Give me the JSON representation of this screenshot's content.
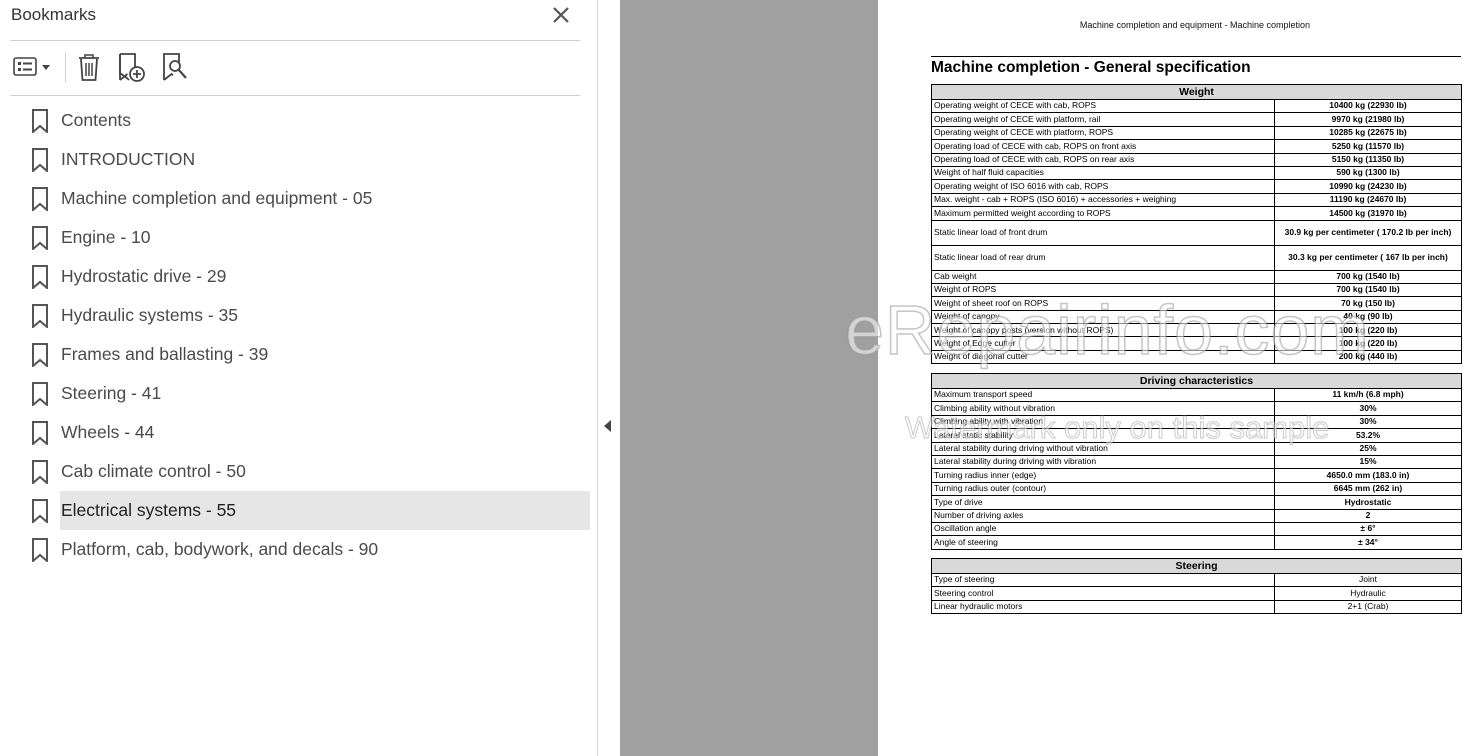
{
  "bookmarks_panel": {
    "title": "Bookmarks",
    "toolbar": {
      "options_icon": "list-options-icon",
      "delete_icon": "trash-icon",
      "new_bookmark_icon": "bookmark-add-icon",
      "find_bookmark_icon": "bookmark-search-icon"
    },
    "items": [
      {
        "label": "Contents"
      },
      {
        "label": "INTRODUCTION"
      },
      {
        "label": "Machine completion and equipment - 05"
      },
      {
        "label": "Engine - 10"
      },
      {
        "label": "Hydrostatic drive - 29"
      },
      {
        "label": "Hydraulic systems - 35"
      },
      {
        "label": "Frames and ballasting - 39"
      },
      {
        "label": "Steering - 41"
      },
      {
        "label": "Wheels - 44"
      },
      {
        "label": "Cab climate control - 50"
      },
      {
        "label": "Electrical systems - 55",
        "selected": true
      },
      {
        "label": "Platform, cab, bodywork, and decals - 90"
      }
    ]
  },
  "document": {
    "header": "Machine completion and equipment - Machine completion",
    "title": "Machine completion - General specification",
    "weight": {
      "heading": "Weight",
      "rows": [
        [
          "Operating weight of CECE with cab, ROPS",
          "10400 kg (22930 lb)"
        ],
        [
          "Operating weight of CECE with platform, rail",
          "9970 kg (21980 lb)"
        ],
        [
          "Operating weight of CECE with platform, ROPS",
          "10285 kg (22675 lb)"
        ],
        [
          "Operating load of CECE with cab, ROPS on front axis",
          "5250 kg (11570 lb)"
        ],
        [
          "Operating load of CECE with cab, ROPS on rear axis",
          "5150 kg (11350 lb)"
        ],
        [
          "Weight of half fluid capacities",
          "590 kg (1300 lb)"
        ],
        [
          "Operating weight of ISO 6016 with cab, ROPS",
          "10990 kg (24230 lb)"
        ],
        [
          "Max. weight - cab + ROPS (ISO 6016) + accessories + weighing",
          "11190 kg (24670 lb)"
        ],
        [
          "Maximum permitted weight according to ROPS",
          "14500 kg (31970 lb)"
        ],
        [
          "Static linear load of front drum",
          "30.9 kg per centimeter ( 170.2 lb per inch)"
        ],
        [
          "Static linear load of rear drum",
          "30.3 kg per centimeter ( 167 lb per inch)"
        ],
        [
          "Cab weight",
          "700 kg (1540 lb)"
        ],
        [
          "Weight of ROPS",
          "700 kg (1540 lb)"
        ],
        [
          "Weight of sheet roof on ROPS",
          "70 kg (150 lb)"
        ],
        [
          "Weight of canopy",
          "40 kg (90 lb)"
        ],
        [
          "Weight of canopy posts (version without ROPS)",
          "100 kg (220 lb)"
        ],
        [
          "Weight of Edge cutter",
          "100 kg (220 lb)"
        ],
        [
          "Weight of diagonal cutter",
          "200 kg (440 lb)"
        ]
      ]
    },
    "driving": {
      "heading": "Driving characteristics",
      "rows": [
        [
          "Maximum transport speed",
          "11 km/h (6.8 mph)"
        ],
        [
          "Climbing ability without vibration",
          "30%"
        ],
        [
          "Climbing ability with vibration",
          "30%"
        ],
        [
          "Lateral static stability",
          "53.2%"
        ],
        [
          "Lateral stability during driving without vibration",
          "25%"
        ],
        [
          "Lateral stability during driving with vibration",
          "15%"
        ],
        [
          "Turning radius inner (edge)",
          "4650.0 mm (183.0 in)"
        ],
        [
          "Turning radius outer (contour)",
          "6645 mm (262 in)"
        ],
        [
          "Type of drive",
          "Hydrostatic"
        ],
        [
          "Number of driving axles",
          "2"
        ],
        [
          "Oscillation angle",
          "± 6°"
        ],
        [
          "Angle of steering",
          "± 34°"
        ]
      ]
    },
    "steering": {
      "heading": "Steering",
      "rows": [
        [
          "Type of steering",
          "Joint"
        ],
        [
          "Steering control",
          "Hydraulic"
        ],
        [
          "Linear hydraulic motors",
          "2+1 (Crab)"
        ]
      ]
    },
    "watermark": "eRepairinfo.com",
    "watermark_sub": "Watermark only on this sample"
  }
}
